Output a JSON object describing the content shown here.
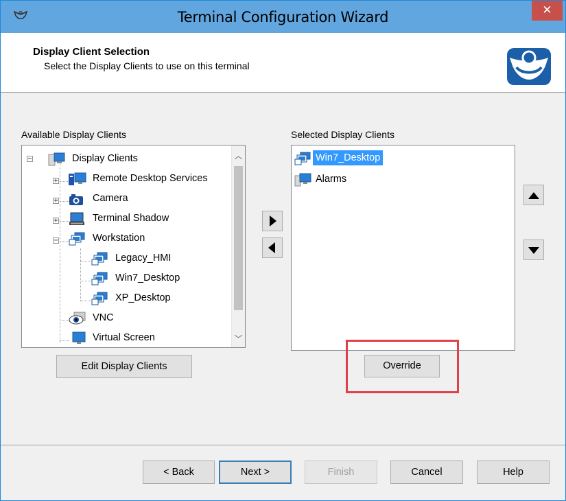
{
  "window": {
    "title": "Terminal Configuration Wizard",
    "close_glyph": "✕"
  },
  "header": {
    "title": "Display Client Selection",
    "subtitle": "Select the Display Clients to use on this terminal"
  },
  "available": {
    "label": "Available Display Clients",
    "tree": [
      {
        "label": "Display Clients",
        "icon": "server-folder-icon"
      },
      {
        "label": "Remote Desktop Services",
        "icon": "remote-desktop-icon"
      },
      {
        "label": "Camera",
        "icon": "camera-icon"
      },
      {
        "label": "Terminal Shadow",
        "icon": "terminal-shadow-icon"
      },
      {
        "label": "Workstation",
        "icon": "workstation-icon"
      },
      {
        "label": "Legacy_HMI",
        "icon": "workstation-icon"
      },
      {
        "label": "Win7_Desktop",
        "icon": "workstation-icon"
      },
      {
        "label": "XP_Desktop",
        "icon": "workstation-icon"
      },
      {
        "label": "VNC",
        "icon": "vnc-eye-icon"
      },
      {
        "label": "Virtual Screen",
        "icon": "virtual-screen-icon"
      }
    ],
    "edit_button": "Edit Display Clients"
  },
  "selected": {
    "label": "Selected Display Clients",
    "items": [
      {
        "label": "Win7_Desktop",
        "icon": "workstation-icon",
        "selected": true
      },
      {
        "label": "Alarms",
        "icon": "alarms-icon",
        "selected": false
      }
    ],
    "override_button": "Override"
  },
  "footer": {
    "back": "< Back",
    "next": "Next >",
    "finish": "Finish",
    "cancel": "Cancel",
    "help": "Help"
  },
  "colors": {
    "title_bar": "#62a6e0",
    "close_button": "#c7504a",
    "selection": "#3399ff",
    "highlight_box": "#e0404a"
  }
}
